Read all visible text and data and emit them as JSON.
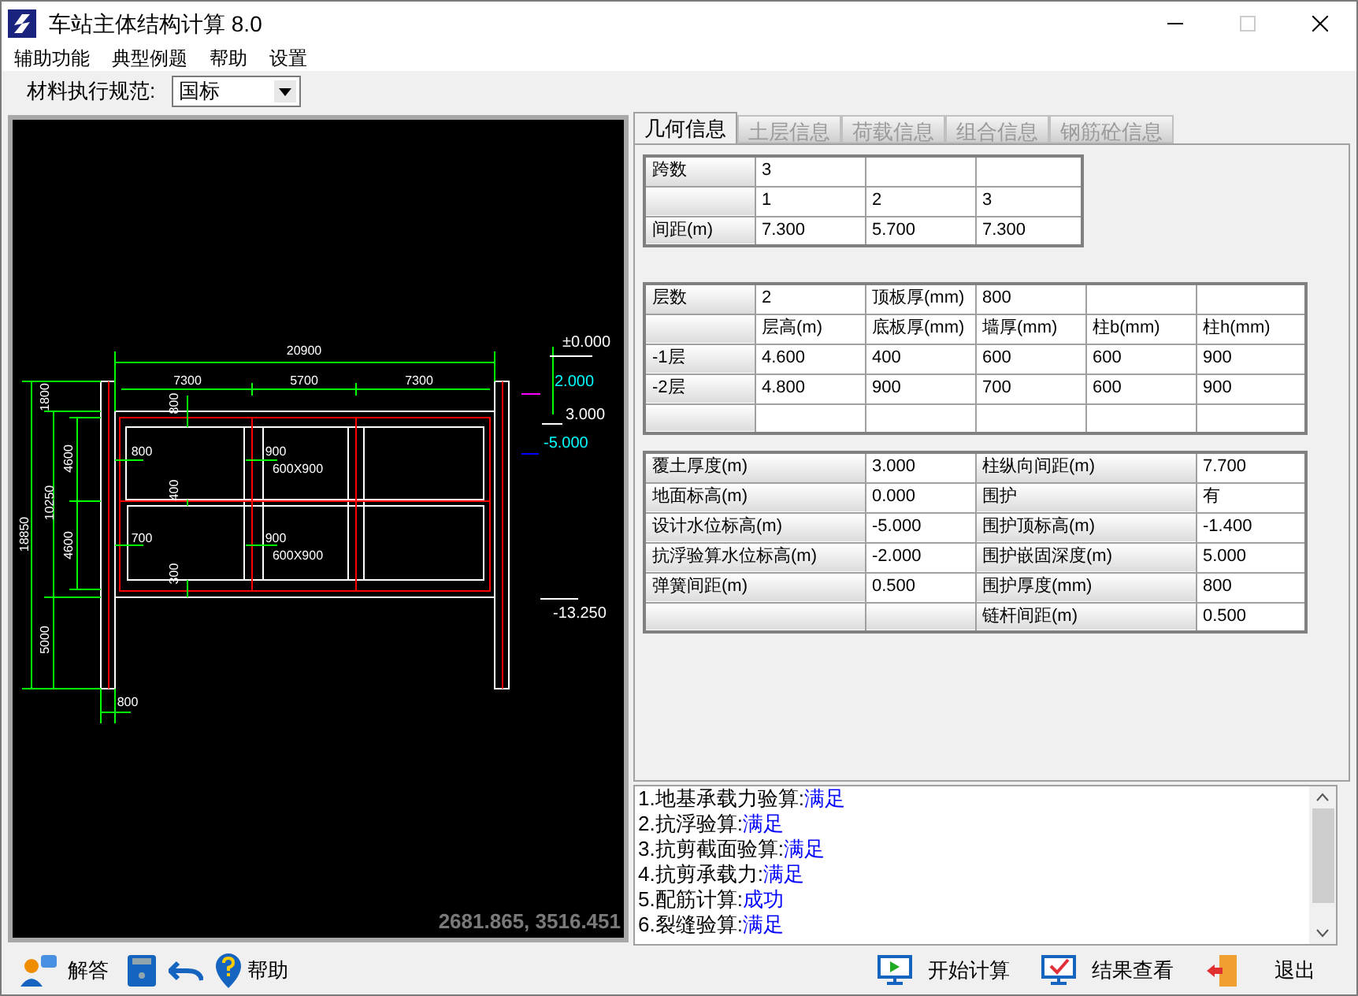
{
  "window": {
    "title": "车站主体结构计算 8.0"
  },
  "menu": [
    "辅助功能",
    "典型例题",
    "帮助",
    "设置"
  ],
  "toolbar": {
    "label": "材料执行规范:",
    "select": {
      "value": "国标"
    }
  },
  "drawing": {
    "labels": [
      {
        "text": "20900"
      },
      {
        "text": "7300"
      },
      {
        "text": "5700"
      },
      {
        "text": "7300"
      },
      {
        "text": "1800"
      },
      {
        "text": "4600"
      },
      {
        "text": "10250"
      },
      {
        "text": "18850"
      },
      {
        "text": "4600"
      },
      {
        "text": "5000"
      },
      {
        "text": "800"
      },
      {
        "text": "800"
      },
      {
        "text": "900"
      },
      {
        "text": "600X900"
      },
      {
        "text": "400"
      },
      {
        "text": "700"
      },
      {
        "text": "900"
      },
      {
        "text": "600X900"
      },
      {
        "text": "300"
      },
      {
        "text": "800"
      },
      {
        "text": "±0.000",
        "color": "#ffffff"
      },
      {
        "text": "2.000",
        "color": "#00ffff"
      },
      {
        "text": "3.000",
        "color": "#ffffff"
      },
      {
        "text": "-5.000",
        "color": "#00ffff"
      },
      {
        "text": "-13.250",
        "color": "#ffffff"
      }
    ],
    "coordinates": "2681.865, 3516.451"
  },
  "tabs": [
    {
      "label": "几何信息",
      "selected": true
    },
    {
      "label": "土层信息",
      "selected": false
    },
    {
      "label": "荷载信息",
      "selected": false
    },
    {
      "label": "组合信息",
      "selected": false
    },
    {
      "label": "钢筋砼信息",
      "selected": false
    }
  ],
  "span_table": {
    "rows": [
      {
        "header": "跨数",
        "cells": [
          "3"
        ]
      },
      {
        "cells": [
          "1",
          "2",
          "3"
        ]
      },
      {
        "header": "间距(m)",
        "cells": [
          "7.300",
          "5.700",
          "7.300"
        ]
      }
    ]
  },
  "floor_table": {
    "rows": [
      {
        "header": "层数",
        "cells": [
          "2",
          "顶板厚(mm)",
          "800"
        ]
      },
      {
        "cells": [
          "层高(m)",
          "底板厚(mm)",
          "墙厚(mm)",
          "柱b(mm)",
          "柱h(mm)"
        ]
      },
      {
        "header": "-1层",
        "cells": [
          "4.600",
          "400",
          "600",
          "600",
          "900"
        ]
      },
      {
        "header": "-2层",
        "cells": [
          "4.800",
          "900",
          "700",
          "600",
          "900"
        ]
      }
    ]
  },
  "param_table": {
    "rows": [
      [
        {
          "label": "覆土厚度(m)",
          "value": "3.000"
        },
        {
          "label": "柱纵向间距(m)",
          "value": "7.700"
        }
      ],
      [
        {
          "label": "地面标高(m)",
          "value": "0.000"
        },
        {
          "label": "围护",
          "value": "有"
        }
      ],
      [
        {
          "label": "设计水位标高(m)",
          "value": "-5.000"
        },
        {
          "label": "围护顶标高(m)",
          "value": "-1.400"
        }
      ],
      [
        {
          "label": "抗浮验算水位标高(m)",
          "value": "-2.000"
        },
        {
          "label": "围护嵌固深度(m)",
          "value": "5.000"
        }
      ],
      [
        {
          "label": "弹簧间距(m)",
          "value": "0.500"
        },
        {
          "label": "围护厚度(mm)",
          "value": "800"
        }
      ],
      [
        null,
        {
          "label": "链杆间距(m)",
          "value": "0.500"
        }
      ]
    ]
  },
  "results": [
    {
      "label": "1.地基承载力验算:",
      "value": "满足"
    },
    {
      "label": "2.抗浮验算:",
      "value": "满足"
    },
    {
      "label": "3.抗剪截面验算:",
      "value": "满足"
    },
    {
      "label": "4.抗剪承载力:",
      "value": "满足"
    },
    {
      "label": "5.配筋计算:",
      "value": "成功"
    },
    {
      "label": "6.裂缝验算:",
      "value": "满足"
    }
  ],
  "bottom_left": {
    "answer": "解答",
    "help": "帮助"
  },
  "bottom_right": [
    "开始计算",
    "结果查看",
    "退出"
  ]
}
